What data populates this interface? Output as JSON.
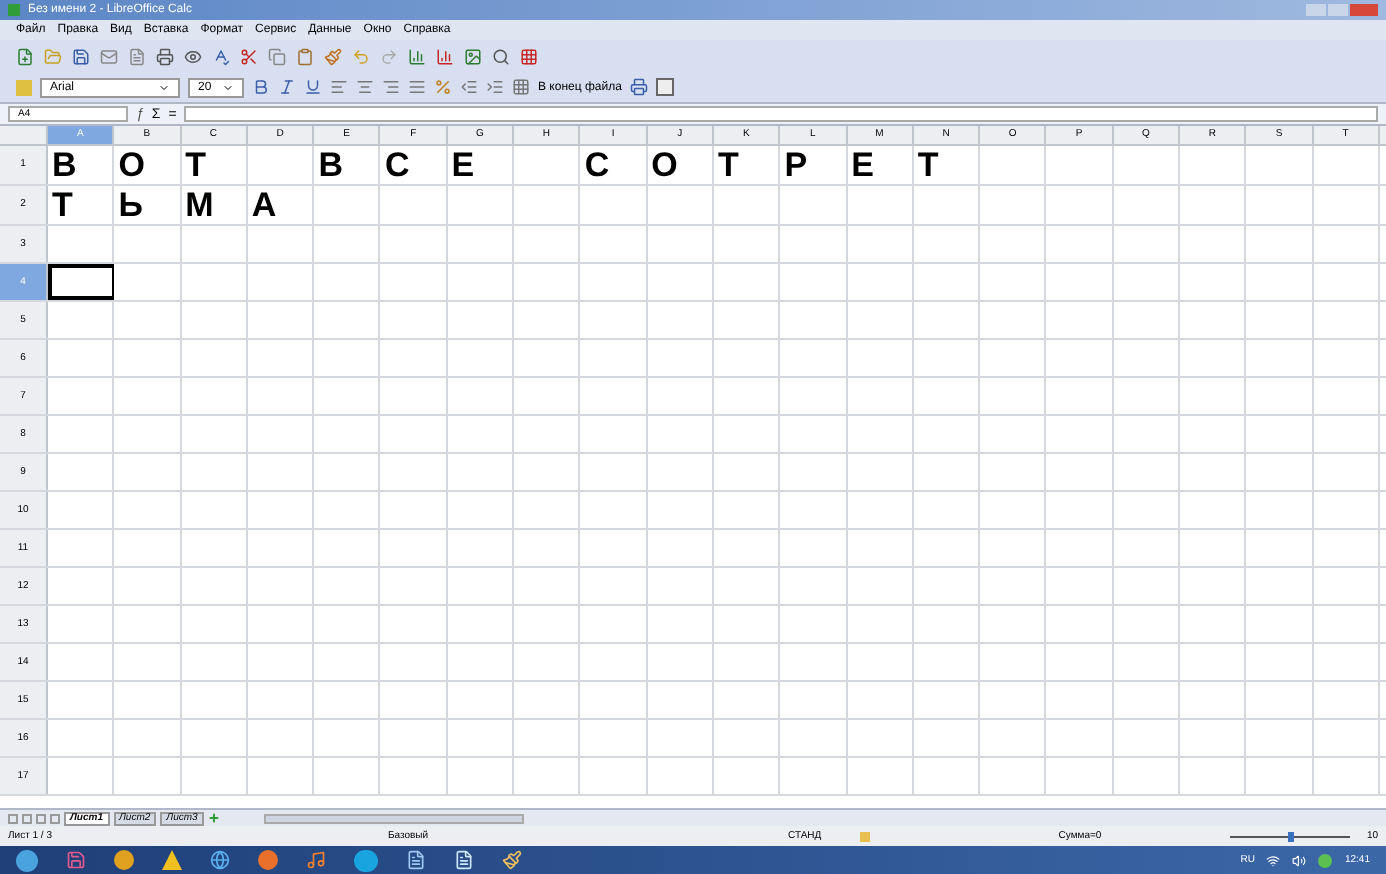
{
  "window": {
    "title": "Без имени 2 - LibreOffice Calc"
  },
  "menu": [
    "Файл",
    "Правка",
    "Вид",
    "Вставка",
    "Формат",
    "Сервис",
    "Данные",
    "Окно",
    "Справка"
  ],
  "format_bar": {
    "font": "Arial",
    "size": "20",
    "end_label": "В конец файла"
  },
  "formula_bar": {
    "name_box": "A4",
    "function_icon": "ƒ",
    "sum_icon": "Σ",
    "equals_icon": "="
  },
  "columns": [
    {
      "label": "A",
      "selected": true
    },
    {
      "label": "B",
      "selected": false
    },
    {
      "label": "C",
      "selected": false
    },
    {
      "label": "D",
      "selected": false
    },
    {
      "label": "E",
      "selected": false
    },
    {
      "label": "F",
      "selected": false
    },
    {
      "label": "G",
      "selected": false
    },
    {
      "label": "H",
      "selected": false
    },
    {
      "label": "I",
      "selected": false
    },
    {
      "label": "J",
      "selected": false
    },
    {
      "label": "K",
      "selected": false
    },
    {
      "label": "L",
      "selected": false
    },
    {
      "label": "M",
      "selected": false
    },
    {
      "label": "N",
      "selected": false
    },
    {
      "label": "O",
      "selected": false
    },
    {
      "label": "P",
      "selected": false
    },
    {
      "label": "Q",
      "selected": false
    },
    {
      "label": "R",
      "selected": false
    },
    {
      "label": "S",
      "selected": false
    },
    {
      "label": "T",
      "selected": false
    }
  ],
  "rows": [
    {
      "label": "1",
      "selected": false,
      "cells": [
        "В",
        "О",
        "Т",
        null,
        "В",
        "С",
        "Е",
        null,
        "С",
        "О",
        "Т",
        "Р",
        "Е",
        "Т"
      ]
    },
    {
      "label": "2",
      "selected": false,
      "cells": [
        "Т",
        "Ь",
        "М",
        "А"
      ]
    },
    {
      "label": "3",
      "selected": false,
      "cells": []
    },
    {
      "label": "4",
      "selected": true,
      "cells": [
        null
      ]
    },
    {
      "label": "5",
      "selected": false,
      "cells": []
    },
    {
      "label": "6",
      "selected": false,
      "cells": []
    },
    {
      "label": "7",
      "selected": false,
      "cells": []
    },
    {
      "label": "8",
      "selected": false,
      "cells": []
    },
    {
      "label": "9",
      "selected": false,
      "cells": []
    },
    {
      "label": "10",
      "selected": false,
      "cells": []
    },
    {
      "label": "11",
      "selected": false,
      "cells": []
    },
    {
      "label": "12",
      "selected": false,
      "cells": []
    },
    {
      "label": "13",
      "selected": false,
      "cells": []
    },
    {
      "label": "14",
      "selected": false,
      "cells": []
    },
    {
      "label": "15",
      "selected": false,
      "cells": []
    },
    {
      "label": "16",
      "selected": false,
      "cells": []
    },
    {
      "label": "17",
      "selected": false,
      "cells": []
    }
  ],
  "sheet_tabs": [
    {
      "label": "Лист1",
      "selected": true
    },
    {
      "label": "Лист2",
      "selected": false
    },
    {
      "label": "Лист3",
      "selected": false
    }
  ],
  "status_bar": {
    "sheet": "Лист 1 / 3",
    "style": "Базовый",
    "mode": "СТАНД",
    "sum": "Сумма=0",
    "zoom": "10",
    "zoom_slider": {
      "level": 0.5
    }
  },
  "taskbar": {
    "language": "RU",
    "time": "12:41"
  }
}
